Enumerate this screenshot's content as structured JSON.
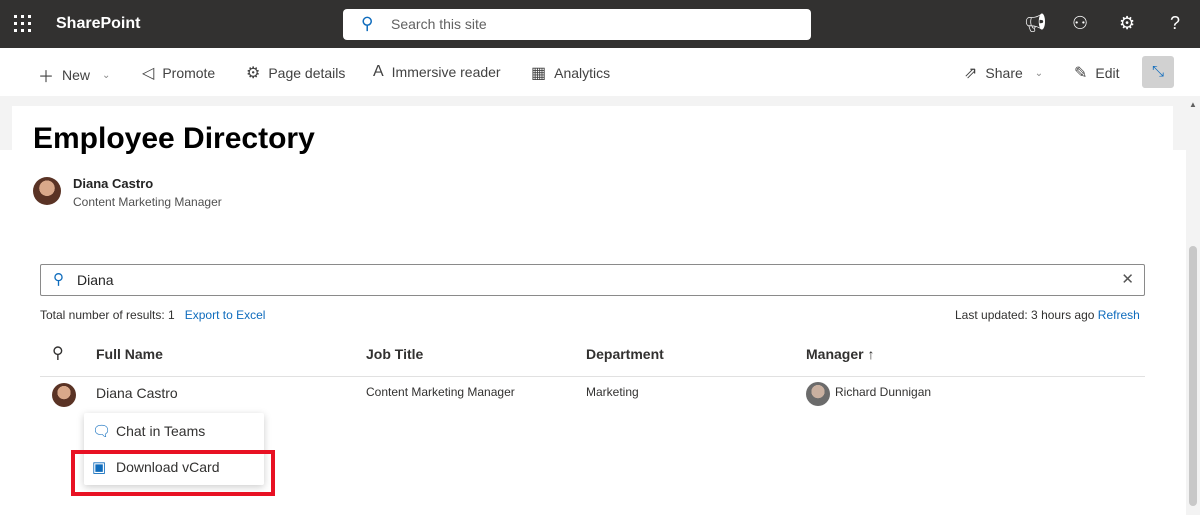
{
  "topbar": {
    "app_name": "SharePoint",
    "search_placeholder": "Search this site",
    "icons": [
      "megaphone-icon",
      "people-icon",
      "gear-icon",
      "help-icon"
    ]
  },
  "commandbar": {
    "new": "New",
    "promote": "Promote",
    "page_details": "Page details",
    "immersive_reader": "Immersive reader",
    "analytics": "Analytics",
    "share": "Share",
    "edit": "Edit"
  },
  "page": {
    "title": "Employee Directory",
    "author_name": "Diana Castro",
    "author_role": "Content Marketing Manager"
  },
  "directory": {
    "search_value": "Diana",
    "total_label": "Total number of results: 1",
    "export": "Export to Excel",
    "last_updated": "Last updated: 3 hours ago",
    "refresh": "Refresh",
    "columns": [
      "Full Name",
      "Job Title",
      "Department",
      "Manager ↑"
    ],
    "rows": [
      {
        "name": "Diana Castro",
        "title": "Content Marketing Manager",
        "department": "Marketing",
        "manager": "Richard Dunnigan"
      }
    ],
    "menu": [
      "Chat in Teams",
      "Download vCard"
    ]
  },
  "colors": {
    "accent": "#0f6cbd",
    "highlight": "#e81123",
    "topbar": "#323130"
  }
}
